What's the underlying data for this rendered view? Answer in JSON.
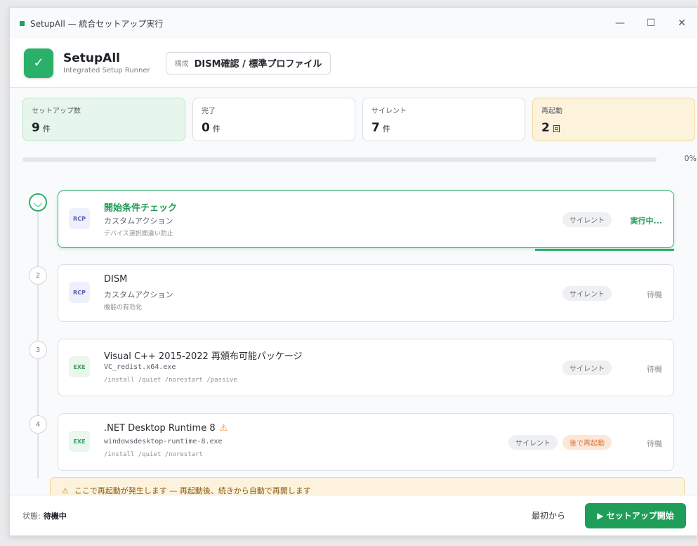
{
  "window": {
    "title": "SetupAll — 統合セットアップ実行",
    "minimize": "—",
    "maximize": "☐",
    "close": "✕"
  },
  "header": {
    "app_name": "SetupAll",
    "app_subtitle": "Integrated Setup Runner",
    "config_label": "構成",
    "config_value": "DISM確認 / 標準プロファイル",
    "app_icon": "check-icon"
  },
  "stats": [
    {
      "label": "セットアップ数",
      "value": "9",
      "unit": "件"
    },
    {
      "label": "完了",
      "value": "0",
      "unit": "件"
    },
    {
      "label": "サイレント",
      "value": "7",
      "unit": "件"
    },
    {
      "label": "再起動",
      "value": "2",
      "unit": "回"
    }
  ],
  "progress": {
    "percent": 0,
    "label": "0%"
  },
  "steps": [
    {
      "number": "",
      "badge": "RCP",
      "title": "開始条件チェック",
      "subtitle": "カスタムアクション",
      "description": "デバイス選択間違い防止",
      "pill": "サイレント",
      "state": "実行中..."
    },
    {
      "number": "2",
      "badge": "RCP",
      "title": "DISM",
      "subtitle": "カスタムアクション",
      "description": "機能の有効化",
      "pill": "サイレント",
      "state": "待機"
    },
    {
      "number": "3",
      "badge": "EXE",
      "title": "Visual C++ 2015-2022 再頒布可能パッケージ",
      "subtitle": "VC_redist.x64.exe",
      "description": "/install /quiet /norestart /passive",
      "pill": "サイレント",
      "state": "待機"
    },
    {
      "number": "4",
      "badge": "EXE",
      "title": ".NET Desktop Runtime 8",
      "subtitle": "windowsdesktop-runtime-8.exe",
      "description": "/install /quiet /norestart",
      "pill": "サイレント",
      "pill2": "後で再起動",
      "state": "待機"
    }
  ],
  "notice": {
    "icon": "warning-icon",
    "text": "ここで再起動が発生します — 再起動後、続きから自動で再開します"
  },
  "footer": {
    "status_label": "状態:",
    "status_value": "待機中",
    "restart_button": "最初から",
    "start_button": "▶ セットアップ開始"
  },
  "colors": {
    "accent": "#1e9e58",
    "warning": "#fdf3dc",
    "reboot_pill": "#fde7d9"
  }
}
